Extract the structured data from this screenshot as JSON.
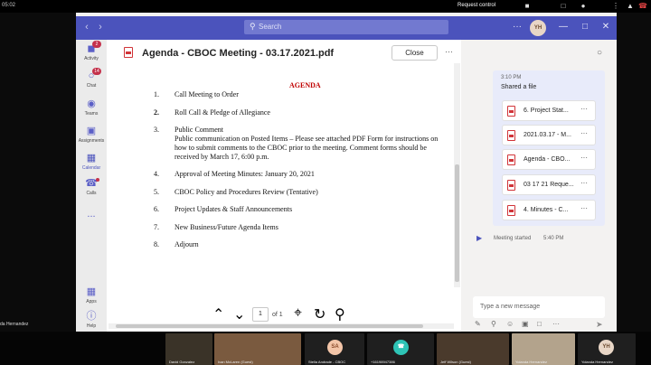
{
  "system": {
    "clock": "05:02",
    "request_control": "Request control",
    "presenter_name": "da Hernandez"
  },
  "header": {
    "search_placeholder": "Search",
    "user_initials": "YH"
  },
  "rail": [
    {
      "label": "Activity",
      "badge": "2"
    },
    {
      "label": "Chat",
      "badge": "14"
    },
    {
      "label": "Teams",
      "badge": ""
    },
    {
      "label": "Assignments",
      "badge": ""
    },
    {
      "label": "Calendar",
      "badge": ""
    },
    {
      "label": "Calls",
      "badge": ""
    },
    {
      "label": "...",
      "badge": ""
    },
    {
      "label": "Apps",
      "badge": ""
    },
    {
      "label": "Help",
      "badge": ""
    }
  ],
  "document": {
    "title": "Agenda - CBOC Meeting - 03.17.2021.pdf",
    "close_label": "Close",
    "more": "···",
    "agenda_heading": "AGENDA",
    "items": [
      {
        "num": "1.",
        "text": "Call Meeting to Order"
      },
      {
        "num": "2.",
        "text": "Roll Call & Pledge of Allegiance"
      },
      {
        "num": "3.",
        "text": "Public Comment"
      },
      {
        "num": "4.",
        "text": "Approval of Meeting Minutes: January 20, 2021"
      },
      {
        "num": "5.",
        "text": "CBOC Policy and Procedures Review (Tentative)"
      },
      {
        "num": "6.",
        "text": "Project Updates & Staff Announcements"
      },
      {
        "num": "7.",
        "text": "New Business/Future Agenda Items"
      },
      {
        "num": "8.",
        "text": "Adjourn"
      }
    ],
    "public_comment_lines": [
      "Public communication on Posted Items – Please see attached PDF Form for instructions on",
      "how to submit comments to the CBOC prior to the meeting.  Comment forms should be",
      "received by March 17, 6:00 p.m."
    ],
    "page_current": "1",
    "page_total": "of 1"
  },
  "chat": {
    "time": "3:10 PM",
    "message": "Shared a file",
    "files": [
      {
        "name": "6. Project Stat..."
      },
      {
        "name": "2021.03.17 - M..."
      },
      {
        "name": "Agenda - CBO..."
      },
      {
        "name": "03 17 21 Reque..."
      },
      {
        "name": "4. Minutes - C..."
      }
    ],
    "meeting_started": "Meeting started",
    "meeting_time": "5:40 PM",
    "compose_placeholder": "Type a new message"
  },
  "participants": [
    {
      "name": "David Gonzalez",
      "initials": ""
    },
    {
      "name": "Ivan McLaren (Guest)",
      "initials": ""
    },
    {
      "name": "Stella Andrade - CBOC",
      "initials": "SA"
    },
    {
      "name": "+16198947386",
      "initials": ""
    },
    {
      "name": "Jeff Wilson (Guest)",
      "initials": ""
    },
    {
      "name": "Yolanda Hernandez",
      "initials": ""
    },
    {
      "name": "Yolanda Hernandez",
      "initials": "YH"
    }
  ],
  "colors": {
    "brand": "#4b53bc",
    "agenda_red": "#c00000",
    "badge": "#c4314b"
  }
}
